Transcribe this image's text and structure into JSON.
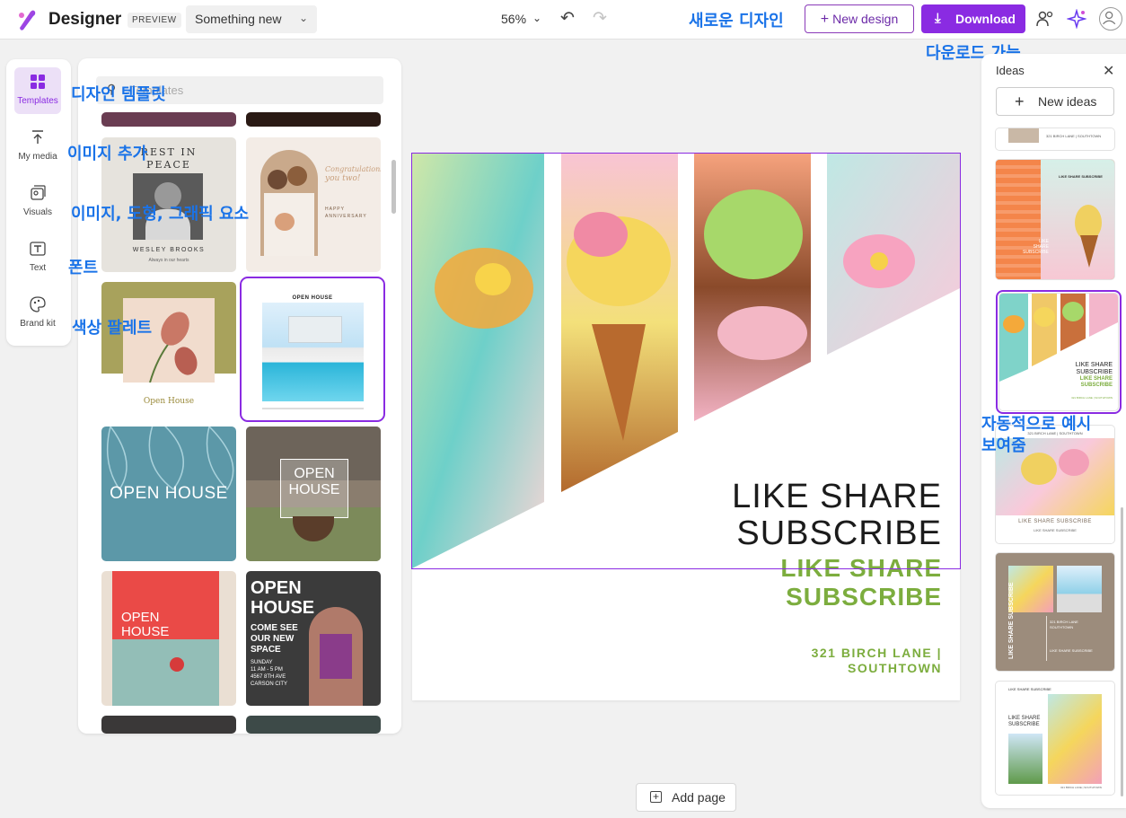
{
  "topbar": {
    "app_name": "Designer",
    "preview_label": "PREVIEW",
    "design_name": "Something new",
    "zoom": "56%",
    "new_design_label": "New design",
    "download_label": "Download"
  },
  "annotations": {
    "new_design": "새로운 디자인",
    "download": "다운로드 가능",
    "templates": "디자인 템플릿",
    "my_media": "이미지 추가",
    "visuals": "이미지, 도형, 그래픽 요소",
    "text": "폰트",
    "brand_kit": "색상 팔레트",
    "ideas": "자동적으로 예시\n보여줌"
  },
  "rail": {
    "items": [
      {
        "label": "Templates",
        "icon": "templates-icon"
      },
      {
        "label": "My media",
        "icon": "upload-icon"
      },
      {
        "label": "Visuals",
        "icon": "visuals-icon"
      },
      {
        "label": "Text",
        "icon": "text-icon"
      },
      {
        "label": "Brand kit",
        "icon": "palette-icon"
      }
    ]
  },
  "templates": {
    "search_placeholder": "Templates",
    "cards": [
      {
        "lines": [
          "REST IN",
          "PEACE",
          "WESLEY BROOKS",
          "Always in our hearts"
        ]
      },
      {
        "lines": [
          "Congratulations",
          "you two!",
          "HAPPY",
          "ANNIVERSARY"
        ]
      },
      {
        "lines": [
          "Open House"
        ]
      },
      {
        "lines": [
          "OPEN HOUSE"
        ]
      },
      {
        "lines": [
          "OPEN HOUSE"
        ]
      },
      {
        "lines": [
          "OPEN",
          "HOUSE"
        ]
      },
      {
        "lines": [
          "OPEN",
          "HOUSE"
        ]
      },
      {
        "lines": [
          "OPEN",
          "HOUSE",
          "COME SEE",
          "OUR NEW",
          "SPACE",
          "SUNDAY",
          "11 AM - 5 PM",
          "4567 8TH AVE",
          "CARSON CITY"
        ]
      }
    ]
  },
  "canvas": {
    "headline": "LIKE SHARE\nSUBSCRIBE",
    "subheadline": "LIKE SHARE\nSUBSCRIBE",
    "address": "321 BIRCH LANE |\nSOUTHTOWN",
    "colors": {
      "green": "#7cad3e",
      "selection": "#8a2be2"
    }
  },
  "add_page_label": "Add page",
  "ideas": {
    "title": "Ideas",
    "new_ideas_label": "New ideas",
    "cards": [
      {
        "lines": [
          "321 BIRCH LANE | SOUTHTOWN"
        ]
      },
      {
        "lines": [
          "LIKE SHARE SUBSCRIBE",
          "LIKE",
          "SHARE",
          "SUBSCRIBE"
        ]
      },
      {
        "lines": [
          "LIKE SHARE",
          "SUBSCRIBE",
          "LIKE SHARE",
          "SUBSCRIBE",
          "321 BIRCH LANE | SOUTHTOWN"
        ]
      },
      {
        "lines": [
          "321 BIRCH LANE | SOUTHTOWN",
          "LIKE SHARE SUBSCRIBE",
          "LIKE SHARE SUBSCRIBE"
        ]
      },
      {
        "lines": [
          "321 BIRCH LANE",
          "SOUTHTOWN",
          "LIKE SHARE SUBSCRIBE",
          "LIKE SHARE SUBSCRIBE"
        ]
      },
      {
        "lines": [
          "LIKE SHARE SUBSCRIBE",
          "LIKE SHARE",
          "SUBSCRIBE",
          "321 BIRCH LANE | SOUTHTOWN"
        ]
      }
    ]
  }
}
